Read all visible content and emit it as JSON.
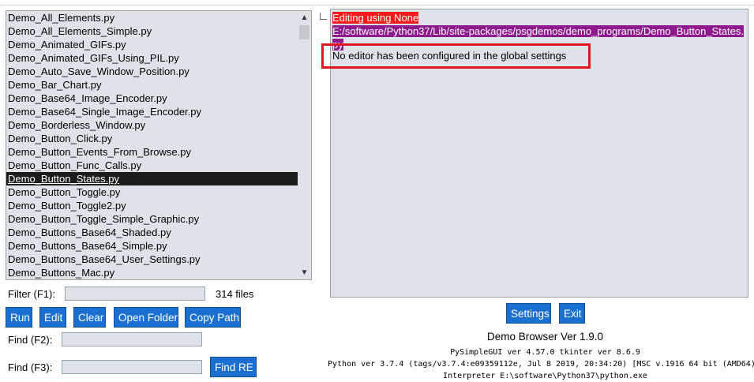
{
  "files": [
    "Demo_All_Elements.py",
    "Demo_All_Elements_Simple.py",
    "Demo_Animated_GIFs.py",
    "Demo_Animated_GIFs_Using_PIL.py",
    "Demo_Auto_Save_Window_Position.py",
    "Demo_Bar_Chart.py",
    "Demo_Base64_Image_Encoder.py",
    "Demo_Base64_Single_Image_Encoder.py",
    "Demo_Borderless_Window.py",
    "Demo_Button_Click.py",
    "Demo_Button_Events_From_Browse.py",
    "Demo_Button_Func_Calls.py",
    "Demo_Button_States.py",
    "Demo_Button_Toggle.py",
    "Demo_Button_Toggle2.py",
    "Demo_Button_Toggle_Simple_Graphic.py",
    "Demo_Buttons_Base64_Shaded.py",
    "Demo_Buttons_Base64_Simple.py",
    "Demo_Buttons_Base64_User_Settings.py",
    "Demo_Buttons_Mac.py"
  ],
  "selected_index": 12,
  "filter": {
    "label": "Filter (F1):",
    "value": "",
    "count": "314 files"
  },
  "buttons": {
    "run": "Run",
    "edit": "Edit",
    "clear": "Clear",
    "open_folder": "Open Folder",
    "copy_path": "Copy Path",
    "find_re": "Find RE",
    "settings": "Settings",
    "exit": "Exit"
  },
  "find": {
    "label": "Find (F2):",
    "value": ""
  },
  "find_re_field": {
    "label": "Find (F3):",
    "value": ""
  },
  "output": {
    "line1": "Editing using None",
    "line2a": "E:/software/Python37/Lib/site-packages/psgdemos/demo_programs/Demo_Button_States.",
    "line2b": "py",
    "line3": "No editor has been configured in the global settings"
  },
  "info": {
    "title": "Demo Browser Ver 1.9.0",
    "versions": "PySimpleGUI ver 4.57.0  tkinter ver 8.6.9",
    "python": "Python ver 3.7.4 (tags/v3.7.4:e09359112e, Jul  8 2019, 20:34:20) [MSC v.1916 64 bit (AMD64)]",
    "interpreter": "Interpreter E:\\software\\Python37\\python.exe"
  },
  "colors": {
    "button_bg": "#1a6fd1",
    "list_bg": "#dde3e8",
    "highlight_red": "#ff1a1a",
    "highlight_purple": "#8e1a8e",
    "annotation_red": "#e01520"
  }
}
